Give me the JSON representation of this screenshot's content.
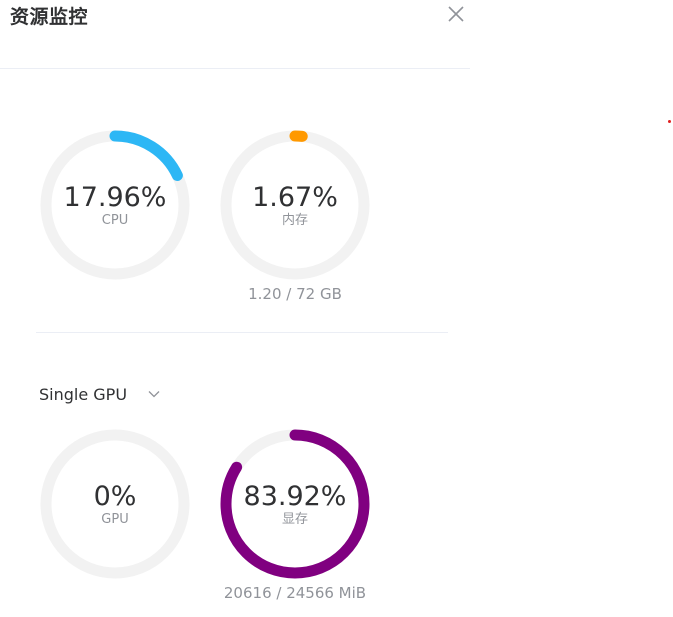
{
  "panel": {
    "title": "资源监控",
    "close_icon": "close-icon"
  },
  "system": {
    "cpu": {
      "value": "17.96%",
      "label": "CPU",
      "fraction": 0.1796,
      "color": "#2db7f5"
    },
    "memory": {
      "value": "1.67%",
      "label": "内存",
      "fraction": 0.0167,
      "color": "#ff9900",
      "detail": "1.20 / 72 GB"
    }
  },
  "gpu_selector": {
    "value": "Single GPU",
    "icon": "chevron-down-icon"
  },
  "gpu": {
    "util": {
      "value": "0%",
      "label": "GPU",
      "fraction": 0,
      "color": "#2db7f5"
    },
    "vram": {
      "value": "83.92%",
      "label": "显存",
      "fraction": 0.8392,
      "color": "#800080",
      "detail": "20616 / 24566 MiB"
    }
  },
  "colors": {
    "track": "#f2f2f2",
    "text_primary": "#303133",
    "text_secondary": "#909399"
  }
}
